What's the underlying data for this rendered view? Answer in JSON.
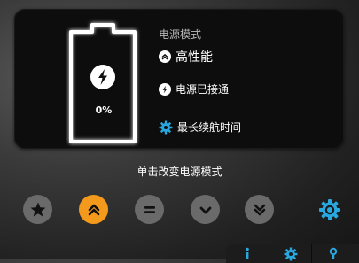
{
  "status": {
    "battery_percent_label": "0%",
    "battery_level": 0,
    "power_mode_title": "电源模式",
    "power_mode_value": "高性能",
    "connection_status": "电源已接通",
    "best_life_link": "最长续航时间"
  },
  "hint": "单击改变电源模式",
  "mode_buttons": [
    {
      "name": "star",
      "active": false
    },
    {
      "name": "double-chevron-up",
      "active": true
    },
    {
      "name": "equals",
      "active": false
    },
    {
      "name": "chevron-down",
      "active": false
    },
    {
      "name": "double-chevron-down",
      "active": false
    }
  ],
  "icons": {
    "settings": "gear-icon",
    "bottom_bar": [
      "info-icon",
      "gear-icon",
      "person-icon"
    ]
  },
  "colors": {
    "accent_orange": "#f39a1d",
    "accent_blue": "#29a8e0",
    "button_gray": "#6a6a6a",
    "panel_bg": "#0d0d0d"
  }
}
